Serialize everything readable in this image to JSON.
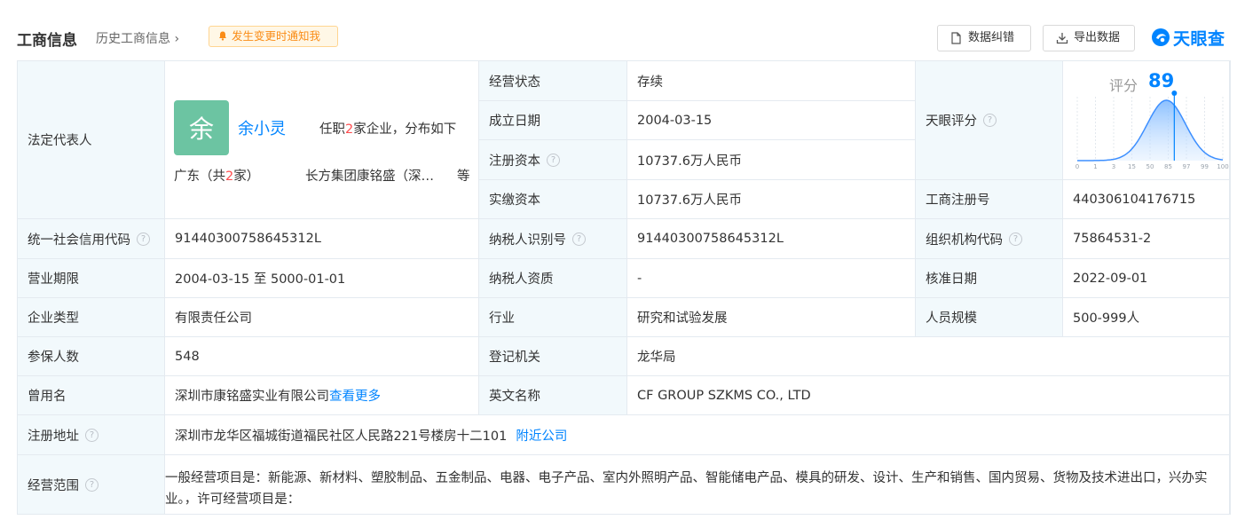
{
  "header": {
    "title": "工商信息",
    "history_link": "历史工商信息",
    "notify_button": "发生变更时通知我",
    "correct_button": "数据纠错",
    "export_button": "导出数据",
    "brand": "天眼查"
  },
  "legal_rep": {
    "label": "法定代表人",
    "avatar_char": "余",
    "name": "余小灵",
    "desc_pre": "任职",
    "count": "2",
    "desc_post": "家企业，分布如下",
    "region_pre": "广东（共",
    "region_count": "2",
    "region_post": "家）",
    "company": "长方集团康铭盛（深…",
    "etc": "等"
  },
  "fields": {
    "status_label": "经营状态",
    "status_value": "存续",
    "founded_label": "成立日期",
    "founded_value": "2004-03-15",
    "reg_capital_label": "注册资本",
    "reg_capital_value": "10737.6万人民币",
    "paid_capital_label": "实缴资本",
    "paid_capital_value": "10737.6万人民币",
    "score_label": "天眼评分",
    "reg_no_label": "工商注册号",
    "reg_no_value": "440306104176715",
    "credit_code_label": "统一社会信用代码",
    "credit_code_value": "91440300758645312L",
    "taxpayer_id_label": "纳税人识别号",
    "taxpayer_id_value": "91440300758645312L",
    "org_code_label": "组织机构代码",
    "org_code_value": "75864531-2",
    "term_label": "营业期限",
    "term_value": "2004-03-15 至 5000-01-01",
    "taxpayer_qual_label": "纳税人资质",
    "taxpayer_qual_value": "-",
    "approved_label": "核准日期",
    "approved_value": "2022-09-01",
    "type_label": "企业类型",
    "type_value": "有限责任公司",
    "industry_label": "行业",
    "industry_value": "研究和试验发展",
    "staff_label": "人员规模",
    "staff_value": "500-999人",
    "insured_label": "参保人数",
    "insured_value": "548",
    "registry_label": "登记机关",
    "registry_value": "龙华局",
    "former_label": "曾用名",
    "former_value": "深圳市康铭盛实业有限公司",
    "former_more": "查看更多",
    "english_label": "英文名称",
    "english_value": "CF GROUP SZKMS CO., LTD",
    "address_label": "注册地址",
    "address_value": "深圳市龙华区福城街道福民社区人民路221号楼房十二101",
    "nearby": "附近公司",
    "scope_label": "经营范围",
    "scope_value": "一般经营项目是：新能源、新材料、塑胶制品、五金制品、电器、电子产品、室内外照明产品、智能储电产品、模具的研发、设计、生产和销售、国内贸易、货物及技术进出口，兴办实业。，许可经营项目是："
  },
  "score": {
    "label": "评分",
    "value": "89",
    "value_num": 89,
    "axis_ticks": [
      "0",
      "1",
      "3",
      "15",
      "50",
      "85",
      "97",
      "99",
      "100"
    ]
  },
  "colors": {
    "accent": "#0084ff",
    "label_bg": "#f2f9fc",
    "avatar_bg": "#6cc4a2",
    "notify": "#fa8c16",
    "highlight": "#ff4d4f"
  }
}
